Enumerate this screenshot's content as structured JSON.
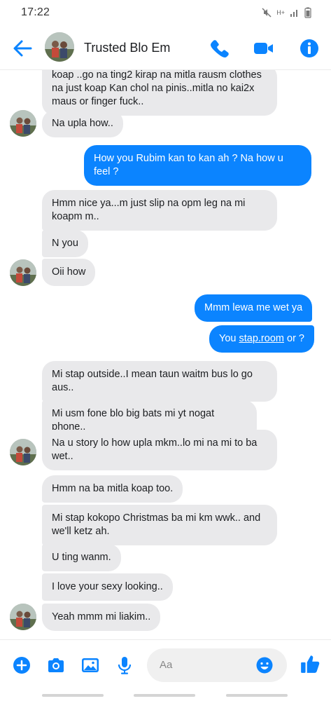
{
  "status_bar": {
    "time": "17:22",
    "network": "H+"
  },
  "header": {
    "title": "Trusted Blo Em",
    "accent_color": "#0b84ff"
  },
  "messages": [
    {
      "side": "in",
      "lines": [
        "koap ..go na ting2 kirap na mitla rausm clothes",
        "na just koap Kan chol na pinis..mitla no kai2x",
        "maus or finger fuck.."
      ]
    },
    {
      "side": "in",
      "lines": [
        "Na upla how.."
      ]
    },
    {
      "side": "out",
      "lines": [
        "How you Rubim kan to kan ah ? Na how u",
        "feel ?"
      ]
    },
    {
      "side": "in",
      "lines": [
        "Hmm nice ya...m just slip na opm leg na mi",
        "koapm m.."
      ]
    },
    {
      "side": "in",
      "lines": [
        "N you"
      ]
    },
    {
      "side": "in",
      "lines": [
        "Oii how"
      ]
    },
    {
      "side": "out",
      "lines": [
        "Mmm lewa me wet ya"
      ]
    },
    {
      "side": "out",
      "prefix": "You ",
      "link": "stap.room",
      "suffix": " or ?"
    },
    {
      "side": "in",
      "lines": [
        "Mi stap outside..I mean taun waitm bus lo go",
        "aus.."
      ]
    },
    {
      "side": "in",
      "lines": [
        "Mi usm fone blo big bats mi yt nogat phone.."
      ]
    },
    {
      "side": "in",
      "lines": [
        "Na u story lo how upla mkm..lo mi na mi to ba",
        "wet.."
      ]
    },
    {
      "side": "in",
      "lines": [
        "Hmm na ba mitla koap too."
      ]
    },
    {
      "side": "in",
      "lines": [
        "Mi stap kokopo Christmas ba mi km wwk.. and",
        "we'll ketz ah."
      ]
    },
    {
      "side": "in",
      "lines": [
        "U ting wanm."
      ]
    },
    {
      "side": "in",
      "lines": [
        "I love your sexy looking.."
      ]
    },
    {
      "side": "in",
      "lines": [
        "Yeah mmm mi liakim.."
      ]
    }
  ],
  "composer": {
    "placeholder": "Aa"
  }
}
